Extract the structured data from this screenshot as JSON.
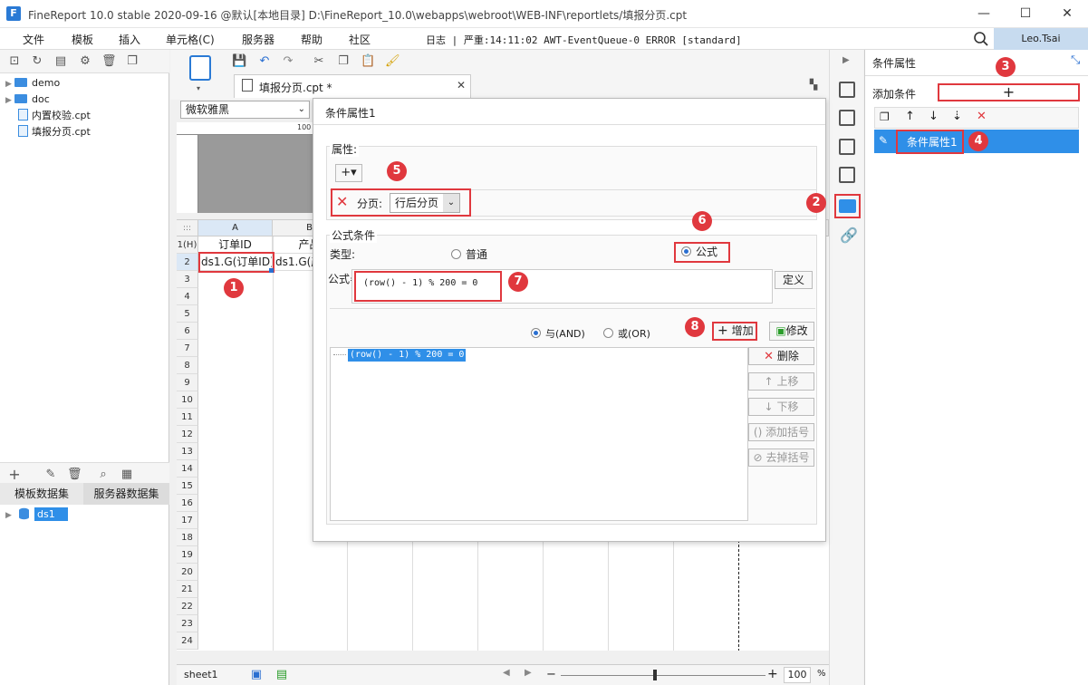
{
  "window": {
    "logo": "F",
    "title": "FineReport 10.0 stable 2020-09-16 @默认[本地目录]    D:\\FineReport_10.0\\webapps\\webroot\\WEB-INF\\reportlets/填报分页.cpt",
    "minimize": "—",
    "maximize": "☐",
    "close": "✕"
  },
  "menu": {
    "items": [
      "文件",
      "模板",
      "插入",
      "单元格(C)",
      "服务器",
      "帮助",
      "社区"
    ],
    "log": "日志 | 严重:14:11:02 AWT-EventQueue-0 ERROR [standard]",
    "user": "Leo.Tsai"
  },
  "tree": {
    "items": [
      {
        "label": "demo",
        "type": "folder"
      },
      {
        "label": "doc",
        "type": "folder"
      },
      {
        "label": "内置校验.cpt",
        "type": "file"
      },
      {
        "label": "填报分页.cpt",
        "type": "file"
      }
    ]
  },
  "datasets": {
    "tabs": [
      "模板数据集",
      "服务器数据集"
    ],
    "items": [
      "ds1"
    ]
  },
  "editor": {
    "tab_label": "填报分页.cpt *",
    "font": "微软雅黑",
    "ruler_mark": "100"
  },
  "sheet": {
    "corner": ":::",
    "columns": [
      "A",
      "B"
    ],
    "rows": [
      "1(H)",
      "2",
      "3",
      "4",
      "5",
      "6",
      "7",
      "8",
      "9",
      "10",
      "11",
      "12",
      "13",
      "14",
      "15",
      "16",
      "17",
      "18",
      "19",
      "20",
      "21",
      "22",
      "23",
      "24"
    ],
    "a1": "订单ID",
    "b1": "产品",
    "a2": "ds1.G(订单ID)",
    "b2": "ds1.G(产",
    "tab": "sheet1",
    "zoom": "100",
    "zoom_unit": "%"
  },
  "dialog": {
    "title": "条件属性1",
    "attr_label": "属性:",
    "add_symbol": "+▾",
    "paging_label": "分页:",
    "paging_value": "行后分页",
    "formula_cond_label": "公式条件",
    "type_label": "类型:",
    "type_normal": "普通",
    "type_formula": "公式",
    "formula_label": "公式=",
    "formula_value": "(row() - 1) % 200 = 0",
    "define_btn": "定义",
    "and_label": "与(AND)",
    "or_label": "或(OR)",
    "add_btn": "增加",
    "modify_btn": "修改",
    "list_item": "(row() - 1) % 200 = 0",
    "delete_btn": "删除",
    "up_btn": "上移",
    "down_btn": "下移",
    "add_paren_btn": "添加括号",
    "remove_paren_btn": "去掉括号"
  },
  "cond_panel": {
    "title": "条件属性",
    "add_label": "添加条件",
    "add_symbol": "+",
    "item": "条件属性1"
  },
  "callouts": [
    "1",
    "2",
    "3",
    "4",
    "5",
    "6",
    "7",
    "8"
  ],
  "colors": {
    "accent": "#2f8fe8",
    "callout": "#e0383e",
    "selected": "#2f8fe8"
  }
}
